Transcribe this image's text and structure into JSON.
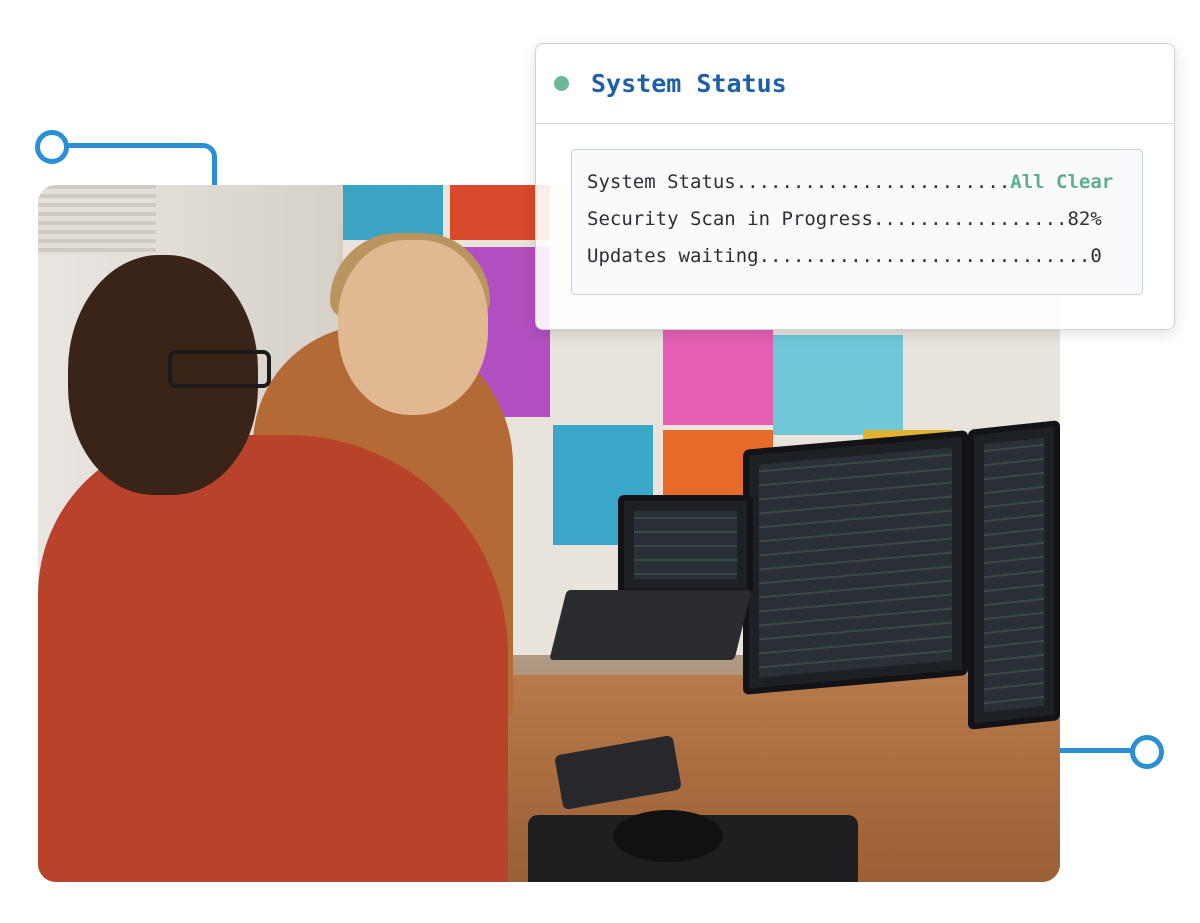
{
  "panel": {
    "title": "System Status",
    "dot_color": "#6bb89b",
    "rows": [
      {
        "label": "System Status",
        "dots": "........................",
        "value": "All Clear",
        "value_color": "#5fae8f"
      },
      {
        "label": "Security Scan in Progress",
        "dots": ".................",
        "value": "82%",
        "value_color": "#2c2f33"
      },
      {
        "label": "Updates waiting",
        "dots": ".............................",
        "value": "0",
        "value_color": "#2c2f33"
      }
    ]
  },
  "accent_color": "#2a8fd4"
}
